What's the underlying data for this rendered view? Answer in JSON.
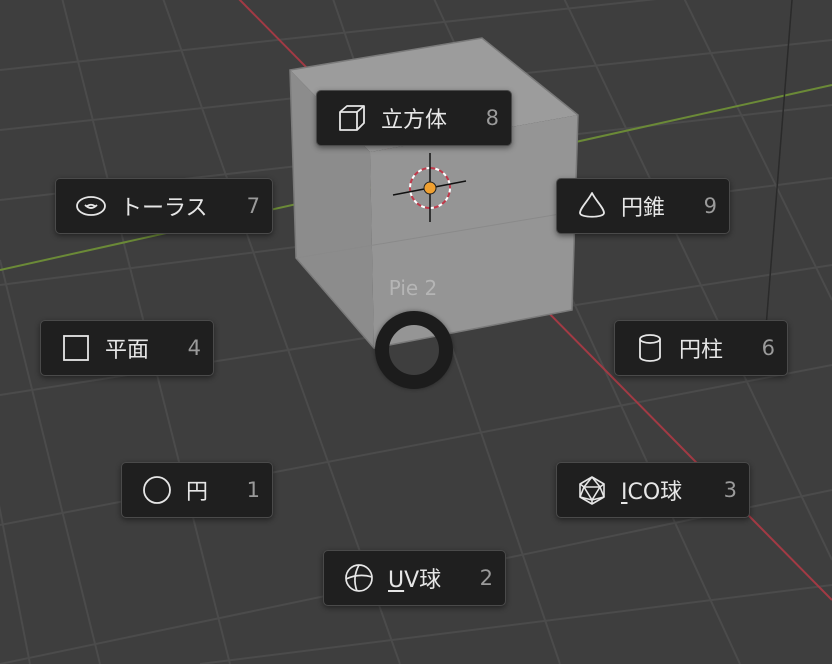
{
  "pie_menu": {
    "title": "Pie 2",
    "items": [
      {
        "id": "cube",
        "label": "立方体",
        "key": "8",
        "icon": "cube-icon"
      },
      {
        "id": "torus",
        "label": "トーラス",
        "key": "7",
        "icon": "torus-icon"
      },
      {
        "id": "cone",
        "label": "円錐",
        "key": "9",
        "icon": "cone-icon"
      },
      {
        "id": "plane",
        "label": "平面",
        "key": "4",
        "icon": "plane-icon"
      },
      {
        "id": "cylinder",
        "label": "円柱",
        "key": "6",
        "icon": "cylinder-icon"
      },
      {
        "id": "circle",
        "label": "円",
        "key": "1",
        "icon": "circle-icon"
      },
      {
        "id": "icosphere",
        "label_underline": "I",
        "label_rest": "CO球",
        "key": "3",
        "icon": "icosphere-icon"
      },
      {
        "id": "uvsphere",
        "label_underline": "U",
        "label_rest": "V球",
        "key": "2",
        "icon": "uv-sphere-icon"
      }
    ]
  },
  "colors": {
    "background": "#3e3e3e",
    "grid": "#4b4b4b",
    "x_axis": "#a23a44",
    "y_axis": "#6b8a37",
    "menu_bg": "#1f1f1f",
    "menu_text": "#e6e6e6",
    "shortcut_text": "#9a9a9a",
    "cursor_dot": "#f0a030"
  }
}
